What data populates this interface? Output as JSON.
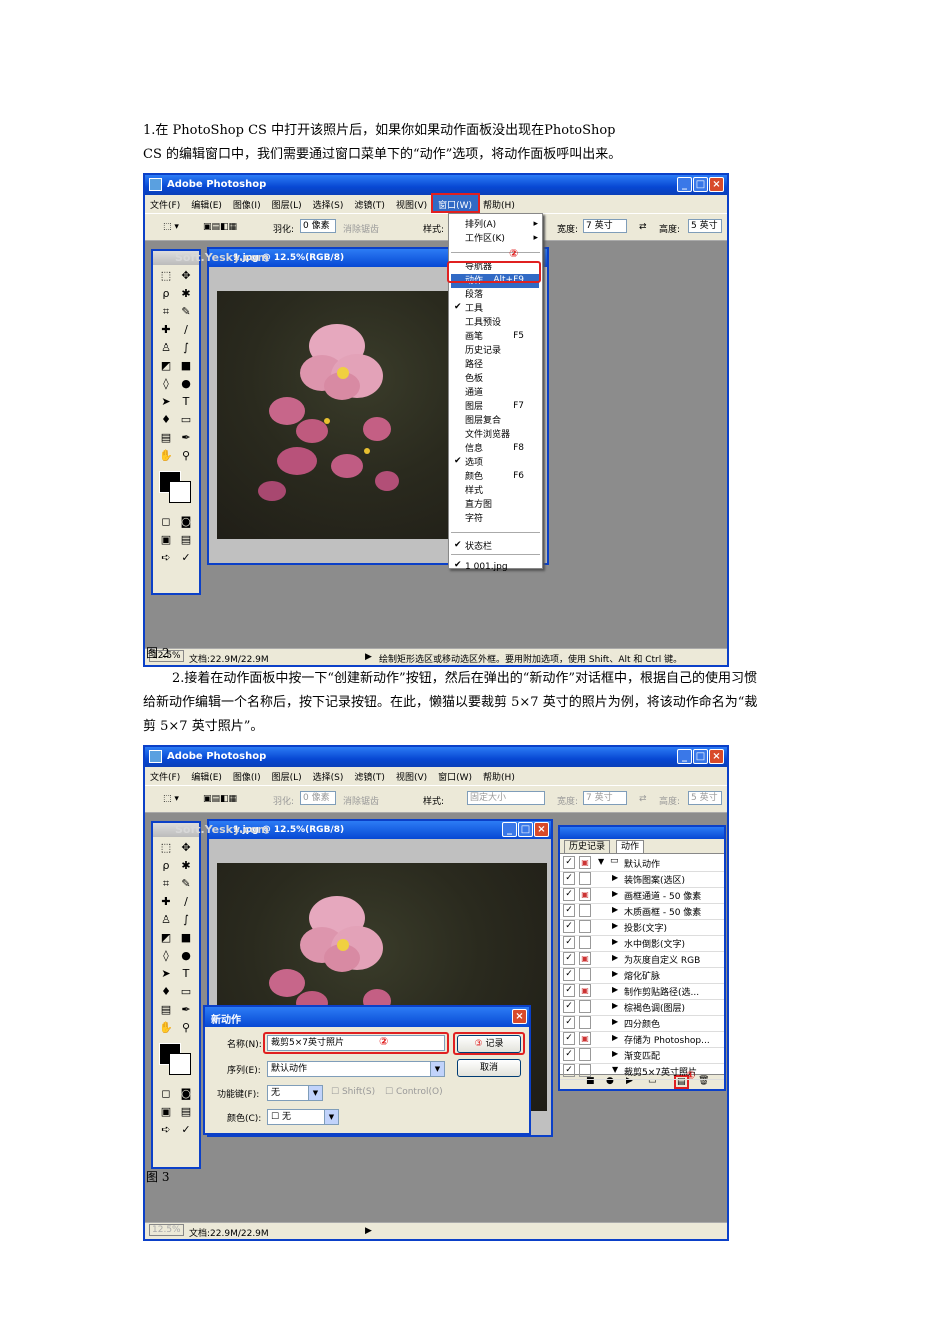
{
  "para1": {
    "line1": "1.在 PhotoShop CS 中打开该照片后，如果你如果动作面板没出现在PhotoShop",
    "line2": "CS 的编辑窗口中，我们需要通过窗口菜单下的“动作”选项，将动作面板呼叫出来。"
  },
  "fig2": {
    "label": "图 2",
    "app_title": "Adobe Photoshop",
    "menus": [
      "文件(F)",
      "编辑(E)",
      "图像(I)",
      "图层(L)",
      "选择(S)",
      "滤镜(T)",
      "视图(V)",
      "窗口(W)",
      "帮助(H)"
    ],
    "options": {
      "feather_label": "羽化:",
      "feather_value": "0 像素",
      "antialias": "消除锯齿",
      "style_label": "样式:",
      "width_label": "宽度:",
      "width_value": "7 英寸",
      "height_label": "高度:",
      "height_value": "5 英寸"
    },
    "doc_title": "1.jpg @ 12.5%(RGB/8)",
    "watermark": "Soft.Yesky.com",
    "window_menu": {
      "items": [
        {
          "label": "排列(A)",
          "arrow": "▸"
        },
        {
          "label": "工作区(K)",
          "arrow": "▸"
        },
        {
          "label": "导航器"
        },
        {
          "label": "动作",
          "shortcut": "Alt+F9",
          "selected": true
        },
        {
          "label": "段落"
        },
        {
          "label": "工具",
          "checked": true
        },
        {
          "label": "工具预设"
        },
        {
          "label": "画笔",
          "shortcut": "F5"
        },
        {
          "label": "历史记录"
        },
        {
          "label": "路径"
        },
        {
          "label": "色板"
        },
        {
          "label": "通道"
        },
        {
          "label": "图层",
          "shortcut": "F7"
        },
        {
          "label": "图层复合"
        },
        {
          "label": "文件浏览器"
        },
        {
          "label": "信息",
          "shortcut": "F8"
        },
        {
          "label": "选项",
          "checked": true
        },
        {
          "label": "颜色",
          "shortcut": "F6"
        },
        {
          "label": "样式"
        },
        {
          "label": "直方图"
        },
        {
          "label": "字符"
        },
        {
          "label": "状态栏",
          "checked": true
        },
        {
          "label": "1 001.jpg",
          "checked": true
        }
      ],
      "marker1": "①",
      "marker2": "②"
    },
    "status": {
      "zoom": "12.5%",
      "doc": "文档:22.9M/22.9M",
      "hint": "绘制矩形选区或移动选区外框。要用附加选项，使用 Shift、Alt 和 Ctrl 键。"
    }
  },
  "para2": {
    "line1": "2.接着在动作面板中按一下“创建新动作”按钮，然后在弹出的“新动作”对话框中，根据自己的使用习惯",
    "line2": "给新动作编辑一个名称后，按下记录按钮。在此，懒猫以要裁剪 5×7 英寸的照片为例，将该动作命名为“裁",
    "line3": "剪 5×7 英寸照片”。"
  },
  "fig3": {
    "label": "图 3",
    "app_title": "Adobe Photoshop",
    "menus": [
      "文件(F)",
      "编辑(E)",
      "图像(I)",
      "图层(L)",
      "选择(S)",
      "滤镜(T)",
      "视图(V)",
      "窗口(W)",
      "帮助(H)"
    ],
    "options": {
      "feather_label": "羽化:",
      "feather_value": "0 像素",
      "antialias": "消除锯齿",
      "style_label": "样式:",
      "style_value": "固定大小",
      "width_label": "宽度:",
      "width_value": "7 英寸",
      "height_label": "高度:",
      "height_value": "5 英寸"
    },
    "doc_title": "1.jpg @ 12.5%(RGB/8)",
    "watermark": "Soft.Yesky.com",
    "panel": {
      "tabs": [
        "历史记录",
        "动作"
      ],
      "rows": [
        {
          "label": "默认动作",
          "folder": true
        },
        {
          "label": "装饰图案(选区)"
        },
        {
          "label": "画框通道 - 50 像素",
          "dialog": true
        },
        {
          "label": "木质画框 - 50 像素"
        },
        {
          "label": "投影(文字)"
        },
        {
          "label": "水中倒影(文字)"
        },
        {
          "label": "为灰度自定义 RGB",
          "dialog": true
        },
        {
          "label": "熔化矿脉"
        },
        {
          "label": "制作剪贴路径(选...",
          "dialog": true
        },
        {
          "label": "棕褐色调(图层)"
        },
        {
          "label": "四分颜色"
        },
        {
          "label": "存储为 Photoshop...",
          "dialog": true
        },
        {
          "label": "渐变匹配"
        },
        {
          "label": "裁剪5×7英寸照片",
          "open": true
        }
      ],
      "marker1": "①"
    },
    "dialog": {
      "title": "新动作",
      "name_label": "名称(N):",
      "name_value": "裁剪5×7英寸照片",
      "set_label": "序列(E):",
      "set_value": "默认动作",
      "fkey_label": "功能键(F):",
      "fkey_value": "无",
      "shift_label": "Shift(S)",
      "control_label": "Control(O)",
      "color_label": "颜色(C):",
      "color_value": "无",
      "record_button": "记录",
      "cancel_button": "取消",
      "marker2": "②",
      "marker3": "③"
    },
    "status": {
      "zoom": "12.5%",
      "doc": "文档:22.9M/22.9M"
    }
  }
}
